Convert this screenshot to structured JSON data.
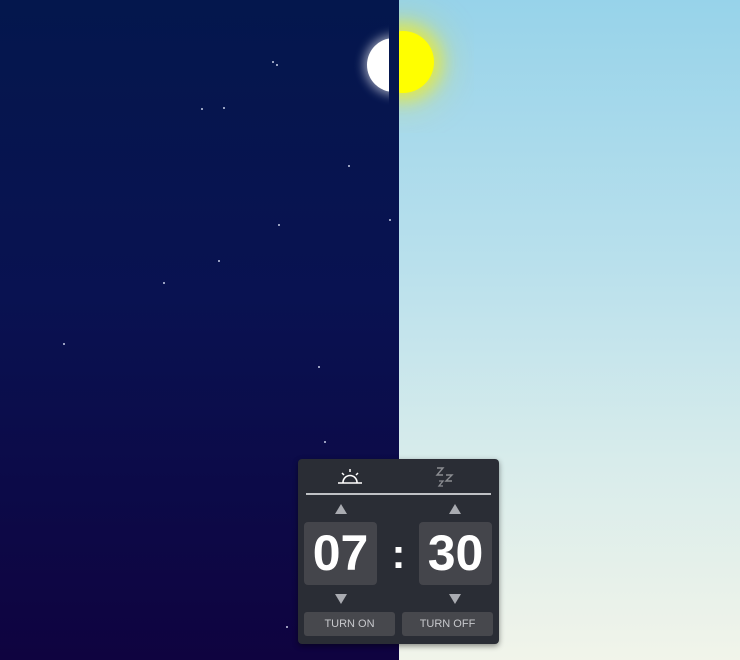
{
  "scene": {
    "night_color_top": "#04174d",
    "night_color_bottom": "#0f0340",
    "day_color_top": "#97d3ea",
    "day_color_bottom": "#f1f4ea",
    "moon_color": "#ffffff",
    "sun_color": "#ffff00",
    "star_color": "#e9efff"
  },
  "alarm": {
    "tabs": [
      {
        "name": "alarm-mode-tab",
        "icon": "sunrise-icon",
        "active": true
      },
      {
        "name": "sleep-mode-tab",
        "icon": "zzz-icon",
        "active": false
      }
    ],
    "hour": "07",
    "separator": ":",
    "minute": "30",
    "turn_on_label": "TURN ON",
    "turn_off_label": "TURN OFF",
    "panel_color": "#2a2d35",
    "digit_box_color": "#44454b",
    "arrow_color": "#a9abb1"
  }
}
